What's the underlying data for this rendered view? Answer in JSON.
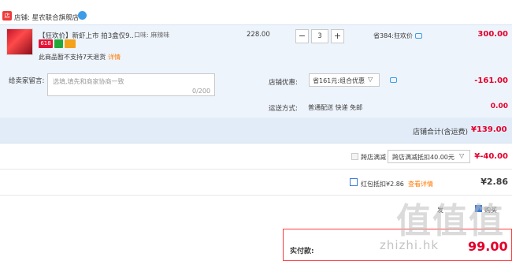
{
  "store": {
    "icon": "store-icon",
    "label": "店铺: 星农联合旗舰店",
    "chat_icon": "wangwang-icon"
  },
  "item": {
    "title": "【狂欢价】新虾上市 拍3盒仅9...",
    "sku": "口味: 麻辣味",
    "unit_price": "228.00",
    "quantity": "3",
    "minus": "−",
    "plus": "+",
    "promo": "省384:狂欢价",
    "subtotal": "300.00",
    "badges": {
      "b618": "618"
    },
    "no_return": "此商品暂不支持7天退货",
    "details": "详情"
  },
  "message": {
    "label": "给卖家留言:",
    "placeholder": "选填,填先和商家协商一致",
    "count": "0/200"
  },
  "coupon": {
    "label": "店铺优惠:",
    "selected": "省161元:组合优惠",
    "amount": "-161.00"
  },
  "shipping": {
    "label": "运送方式:",
    "method": "普通配送 快递 免邮",
    "amount": "0.00"
  },
  "store_total": {
    "label": "店铺合计(含运费)",
    "amount": "¥139.00"
  },
  "cross_store": {
    "label": "跨店满减",
    "selected": "跨店满减抵扣40.00元",
    "amount": "¥-40.00"
  },
  "red_packet": {
    "label": "红包抵扣¥2.86",
    "link": "查看详情",
    "amount": "¥2.86"
  },
  "anonymous": {
    "fragment_left": "发",
    "fragment_right": "购买"
  },
  "pay": {
    "label": "实付款:",
    "amount": "99.00"
  },
  "watermark": {
    "logo": "值值值",
    "url": "zhizhi.hk"
  },
  "colors": {
    "accent_red": "#e4002b",
    "link_orange": "#ff7a00",
    "row_blue": "#eef4fc"
  }
}
